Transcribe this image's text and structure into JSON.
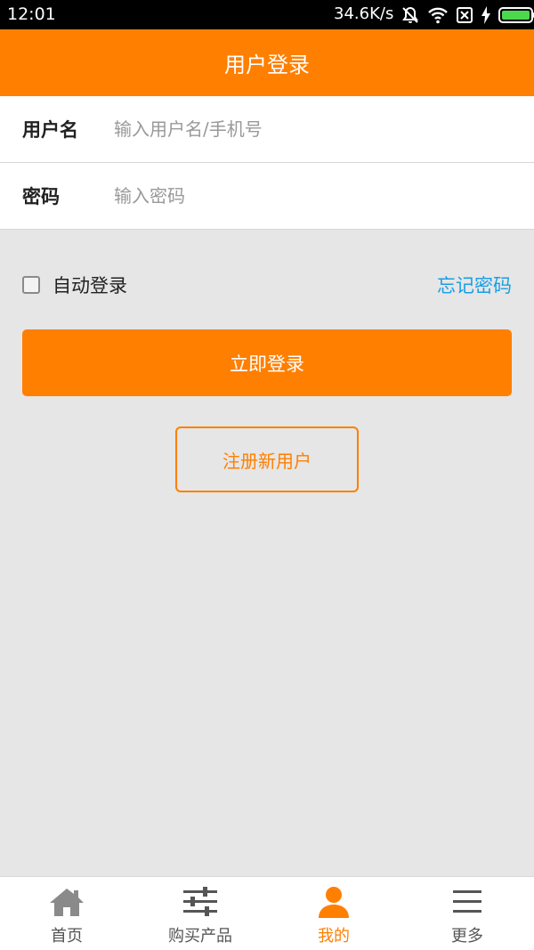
{
  "statusbar": {
    "time": "12:01",
    "network_speed": "34.6K/s"
  },
  "header": {
    "title": "用户登录"
  },
  "form": {
    "username": {
      "label": "用户名",
      "placeholder": "输入用户名/手机号",
      "value": ""
    },
    "password": {
      "label": "密码",
      "placeholder": "输入密码",
      "value": ""
    }
  },
  "options": {
    "auto_login_label": "自动登录",
    "auto_login_checked": false,
    "forgot_label": "忘记密码"
  },
  "buttons": {
    "login_label": "立即登录",
    "register_label": "注册新用户"
  },
  "tabs": [
    {
      "label": "首页",
      "icon": "home-icon"
    },
    {
      "label": "购买产品",
      "icon": "sliders-icon"
    },
    {
      "label": "我的",
      "icon": "user-icon",
      "active": true
    },
    {
      "label": "更多",
      "icon": "menu-icon"
    }
  ],
  "colors": {
    "accent": "#ff7f00",
    "link": "#1a9ee3",
    "background": "#e6e6e6"
  }
}
